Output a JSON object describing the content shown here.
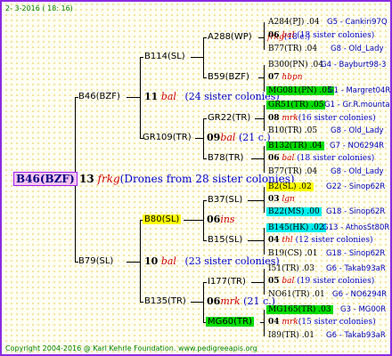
{
  "date": "2- 3-2016 ( 18: 16)",
  "root": {
    "id": "B46(BZF)",
    "num": "13",
    "breed": "frkg",
    "note": "(Drones from 28 sister colonies)"
  },
  "g1": [
    {
      "id": "B46(BZF)",
      "num": "11",
      "breed": "bal",
      "note": "(24 sister colonies)"
    },
    {
      "id": "B79(SL)",
      "num": "10",
      "breed": "bal",
      "note": "(23 sister colonies)"
    }
  ],
  "g2": [
    {
      "id": "B114(SL)",
      "num": "",
      "breed": "",
      "note": ""
    },
    {
      "id": "GR109(TR)",
      "num": "09",
      "breed": "bal",
      "note": "(21 c.)"
    },
    {
      "id": "B80(SL)",
      "num": "06",
      "breed": "ins",
      "note": ""
    },
    {
      "id": "B135(TR)",
      "num": "06",
      "breed": "mrk",
      "note": "(21 c.)"
    }
  ],
  "g3": [
    {
      "id": "A288(WP)",
      "num": "",
      "breed": "frkg",
      "note": "(18 c.)"
    },
    {
      "id": "B59(BZF)",
      "num": "",
      "breed": "",
      "note": ""
    },
    {
      "id": "GR22(TR)",
      "num": "",
      "breed": "",
      "note": ""
    },
    {
      "id": "B78(TR)",
      "num": "",
      "breed": "",
      "note": ""
    },
    {
      "id": "B37(SL)",
      "num": "",
      "breed": "",
      "note": ""
    },
    {
      "id": "B15(SL)",
      "num": "",
      "breed": "",
      "note": ""
    },
    {
      "id": "I177(TR)",
      "num": "",
      "breed": "",
      "note": ""
    },
    {
      "id": "MG60(TR)",
      "num": "",
      "breed": "",
      "note": ""
    }
  ],
  "g4": [
    {
      "id": "A284(PJ)",
      "score": ".04",
      "loc": "G5 - Cankiri97Q",
      "num": "06",
      "breed": "bal",
      "note": "(18 sister colonies)"
    },
    {
      "id": "B77(TR)",
      "score": ".04",
      "loc": "G8 - Old_Lady"
    },
    {
      "id": "B300(PN)",
      "score": ".04",
      "loc": "G4 - Bayburt98-3",
      "num": "07",
      "breed": "hbpn",
      "note": ""
    },
    {
      "id": "MG081(PN)",
      "score": ".05",
      "loc": "G1 - Margret04R"
    },
    {
      "id": "GR51(TR)",
      "score": ".05",
      "loc": "G1 - Gr.R.mounta",
      "num": "08",
      "breed": "mrk",
      "note": "(16 sister colonies)"
    },
    {
      "id": "B10(TR)",
      "score": ".05",
      "loc": "G8 - Old_Lady"
    },
    {
      "id": "B132(TR)",
      "score": ".04",
      "loc": "G7 - NO6294R",
      "num": "06",
      "breed": "bal",
      "note": "(18 sister colonies)"
    },
    {
      "id": "B77(TR)",
      "score": ".04",
      "loc": "G8 - Old_Lady"
    },
    {
      "id": "B2(SL)",
      "score": ".02",
      "loc": "G22 - Sinop62R",
      "num": "03",
      "breed": "lgn",
      "note": ""
    },
    {
      "id": "B22(MS)",
      "score": ".00",
      "loc": "G18 - Sinop62R"
    },
    {
      "id": "B145(HK)",
      "score": ".02",
      "loc": "G13 - AthosSt80R",
      "num": "04",
      "breed": "thl",
      "note": "(12 sister colonies)"
    },
    {
      "id": "B19(CS)",
      "score": ".01",
      "loc": "G18 - Sinop62R"
    },
    {
      "id": "I51(TR)",
      "score": ".03",
      "loc": "G6 - Takab93aR",
      "num": "05",
      "breed": "bal",
      "note": "(19 sister colonies)"
    },
    {
      "id": "NO61(TR)",
      "score": ".01",
      "loc": "G6 - NO6294R"
    },
    {
      "id": "MG165(TR)",
      "score": ".03",
      "loc": "G3 - MG00R",
      "num": "04",
      "breed": "mrk",
      "note": "(15 sister colonies)"
    },
    {
      "id": "I89(TR)",
      "score": ".01",
      "loc": "G6 - Takab93aR"
    }
  ],
  "footer": "Copyright 2004-2016 @ Karl Kehrle Foundation.   www.pedigreeapis.org",
  "colors": {
    "frame": "#8A2BE2",
    "highlight_yellow": "#FFFF00",
    "highlight_green": "#00DD00",
    "highlight_cyan": "#00EEEE",
    "root_bg": "#F7C3EF",
    "breed_red": "#CC0000",
    "sister_blue": "#0000CC",
    "ref_blue": "#0000BB",
    "footer_green": "#008000"
  }
}
